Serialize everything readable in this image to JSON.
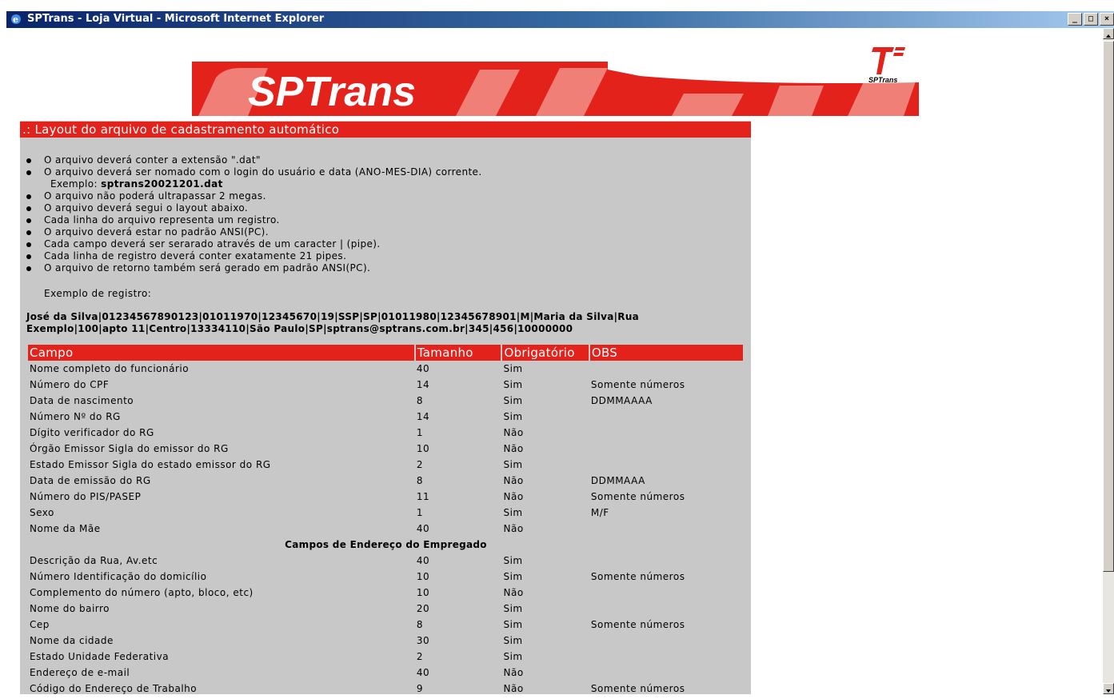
{
  "window": {
    "title": "SPTrans - Loja Virtual - Microsoft Internet Explorer",
    "buttons": [
      "_",
      "□",
      "×"
    ]
  },
  "banner": {
    "brand": "SPTrans",
    "small_logo_text": "SPTrans"
  },
  "panel": {
    "title": ".: Layout do arquivo de cadastramento automático",
    "rules": [
      "O arquivo deverá conter a extensão \".dat\"",
      "O arquivo deverá ser nomado com o login do usuário e data (ANO-MES-DIA) corrente.",
      "O arquivo não poderá ultrapassar 2 megas.",
      "O arquivo deverá segui o layout abaixo.",
      "Cada linha do arquivo representa um registro.",
      "O arquivo deverá estar no padrão ANSI(PC).",
      "Cada campo deverá ser serarado através de um caracter | (pipe).",
      "Cada linha de registro deverá conter exatamente 21 pipes.",
      "O arquivo de retorno também será gerado em padrão ANSI(PC)."
    ],
    "example_prefix": "Exemplo:",
    "example_filename": "sptrans20021201.dat",
    "record_label": "Exemplo de registro:",
    "record_line1": "José da Silva|01234567890123|01011970|12345670|19|SSP|SP|01011980|12345678901|M|Maria da Silva|Rua",
    "record_line2": "Exemplo|100|apto 11|Centro|13334110|São Paulo|SP|sptrans@sptrans.com.br|345|456|10000000"
  },
  "table": {
    "headers": [
      "Campo",
      "Tamanho",
      "Obrigatório",
      "OBS"
    ],
    "rows": [
      [
        "Nome completo do funcionário",
        "40",
        "Sim",
        ""
      ],
      [
        "Número do CPF",
        "14",
        "Sim",
        "Somente números"
      ],
      [
        "Data de nascimento",
        "8",
        "Sim",
        "DDMMAAAA"
      ],
      [
        "Número Nº do RG",
        "14",
        "Sim",
        ""
      ],
      [
        "Dígito verificador do RG",
        "1",
        "Não",
        ""
      ],
      [
        "Órgão Emissor Sigla do emissor do RG",
        "10",
        "Não",
        ""
      ],
      [
        "Estado Emissor Sigla do estado emissor do RG",
        "2",
        "Sim",
        ""
      ],
      [
        "Data de emissão do RG",
        "8",
        "Não",
        "DDMMAAA"
      ],
      [
        "Número do PIS/PASEP",
        "11",
        "Não",
        "Somente números"
      ],
      [
        "Sexo",
        "1",
        "Sim",
        "M/F"
      ],
      [
        "Nome da Mãe",
        "40",
        "Não",
        ""
      ]
    ],
    "section_title": "Campos de Endereço do Empregado",
    "rows2": [
      [
        "Descrição da Rua, Av.etc",
        "40",
        "Sim",
        ""
      ],
      [
        "Número Identificação do domicílio",
        "10",
        "Sim",
        "Somente números"
      ],
      [
        "Complemento do número (apto, bloco, etc)",
        "10",
        "Não",
        ""
      ],
      [
        "Nome do bairro",
        "20",
        "Sim",
        ""
      ],
      [
        "Cep",
        "8",
        "Sim",
        "Somente números"
      ],
      [
        "Nome da cidade",
        "30",
        "Sim",
        ""
      ],
      [
        "Estado Unidade Federativa",
        "2",
        "Sim",
        ""
      ],
      [
        "Endereço de e-mail",
        "40",
        "Não",
        ""
      ],
      [
        "Código do Endereço de Trabalho",
        "9",
        "Não",
        "Somente números"
      ]
    ]
  },
  "colors": {
    "accent_red": "#e3221c",
    "panel_gray": "#c8c8c8",
    "titlebar_blue": "#0a246a"
  }
}
